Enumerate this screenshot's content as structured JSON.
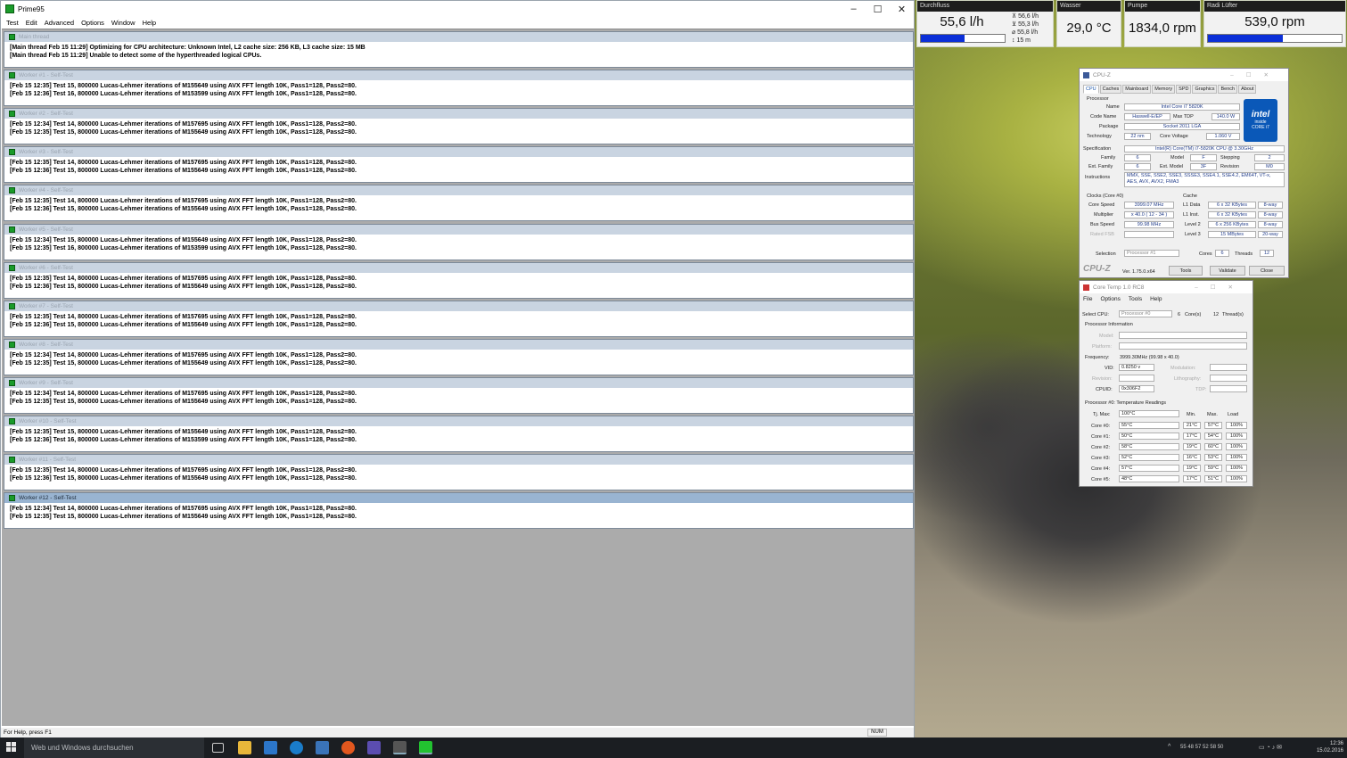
{
  "prime95": {
    "title": "Prime95",
    "menu": [
      "Test",
      "Edit",
      "Advanced",
      "Options",
      "Window",
      "Help"
    ],
    "windows": [
      {
        "caption": "Main thread",
        "lines": [
          "[Main thread Feb 15 11:29] Optimizing for CPU architecture: Unknown Intel, L2 cache size: 256 KB, L3 cache size: 15 MB",
          "[Main thread Feb 15 11:29] Unable to detect some of the hyperthreaded logical CPUs."
        ]
      },
      {
        "caption": "Worker #1 - Self-Test",
        "lines": [
          "[Feb 15 12:35] Test 15, 800000 Lucas-Lehmer iterations of M155649 using AVX FFT length 10K, Pass1=128, Pass2=80.",
          "[Feb 15 12:36] Test 16, 800000 Lucas-Lehmer iterations of M153599 using AVX FFT length 10K, Pass1=128, Pass2=80."
        ]
      },
      {
        "caption": "Worker #2 - Self-Test",
        "lines": [
          "[Feb 15 12:34] Test 14, 800000 Lucas-Lehmer iterations of M157695 using AVX FFT length 10K, Pass1=128, Pass2=80.",
          "[Feb 15 12:35] Test 15, 800000 Lucas-Lehmer iterations of M155649 using AVX FFT length 10K, Pass1=128, Pass2=80."
        ]
      },
      {
        "caption": "Worker #3 - Self-Test",
        "lines": [
          "[Feb 15 12:35] Test 14, 800000 Lucas-Lehmer iterations of M157695 using AVX FFT length 10K, Pass1=128, Pass2=80.",
          "[Feb 15 12:36] Test 15, 800000 Lucas-Lehmer iterations of M155649 using AVX FFT length 10K, Pass1=128, Pass2=80."
        ]
      },
      {
        "caption": "Worker #4 - Self-Test",
        "lines": [
          "[Feb 15 12:35] Test 14, 800000 Lucas-Lehmer iterations of M157695 using AVX FFT length 10K, Pass1=128, Pass2=80.",
          "[Feb 15 12:36] Test 15, 800000 Lucas-Lehmer iterations of M155649 using AVX FFT length 10K, Pass1=128, Pass2=80."
        ]
      },
      {
        "caption": "Worker #5 - Self-Test",
        "lines": [
          "[Feb 15 12:34] Test 15, 800000 Lucas-Lehmer iterations of M155649 using AVX FFT length 10K, Pass1=128, Pass2=80.",
          "[Feb 15 12:35] Test 16, 800000 Lucas-Lehmer iterations of M153599 using AVX FFT length 10K, Pass1=128, Pass2=80."
        ]
      },
      {
        "caption": "Worker #6 - Self-Test",
        "lines": [
          "[Feb 15 12:35] Test 14, 800000 Lucas-Lehmer iterations of M157695 using AVX FFT length 10K, Pass1=128, Pass2=80.",
          "[Feb 15 12:36] Test 15, 800000 Lucas-Lehmer iterations of M155649 using AVX FFT length 10K, Pass1=128, Pass2=80."
        ]
      },
      {
        "caption": "Worker #7 - Self-Test",
        "lines": [
          "[Feb 15 12:35] Test 14, 800000 Lucas-Lehmer iterations of M157695 using AVX FFT length 10K, Pass1=128, Pass2=80.",
          "[Feb 15 12:36] Test 15, 800000 Lucas-Lehmer iterations of M155649 using AVX FFT length 10K, Pass1=128, Pass2=80."
        ]
      },
      {
        "caption": "Worker #8 - Self-Test",
        "lines": [
          "[Feb 15 12:34] Test 14, 800000 Lucas-Lehmer iterations of M157695 using AVX FFT length 10K, Pass1=128, Pass2=80.",
          "[Feb 15 12:35] Test 15, 800000 Lucas-Lehmer iterations of M155649 using AVX FFT length 10K, Pass1=128, Pass2=80."
        ]
      },
      {
        "caption": "Worker #9 - Self-Test",
        "lines": [
          "[Feb 15 12:34] Test 14, 800000 Lucas-Lehmer iterations of M157695 using AVX FFT length 10K, Pass1=128, Pass2=80.",
          "[Feb 15 12:35] Test 15, 800000 Lucas-Lehmer iterations of M155649 using AVX FFT length 10K, Pass1=128, Pass2=80."
        ]
      },
      {
        "caption": "Worker #10 - Self-Test",
        "lines": [
          "[Feb 15 12:35] Test 15, 800000 Lucas-Lehmer iterations of M155649 using AVX FFT length 10K, Pass1=128, Pass2=80.",
          "[Feb 15 12:36] Test 16, 800000 Lucas-Lehmer iterations of M153599 using AVX FFT length 10K, Pass1=128, Pass2=80."
        ]
      },
      {
        "caption": "Worker #11 - Self-Test",
        "lines": [
          "[Feb 15 12:35] Test 14, 800000 Lucas-Lehmer iterations of M157695 using AVX FFT length 10K, Pass1=128, Pass2=80.",
          "[Feb 15 12:36] Test 15, 800000 Lucas-Lehmer iterations of M155649 using AVX FFT length 10K, Pass1=128, Pass2=80."
        ]
      },
      {
        "caption": "Worker #12 - Self-Test",
        "lines": [
          "[Feb 15 12:34] Test 14, 800000 Lucas-Lehmer iterations of M157695 using AVX FFT length 10K, Pass1=128, Pass2=80.",
          "[Feb 15 12:35] Test 15, 800000 Lucas-Lehmer iterations of M155649 using AVX FFT length 10K, Pass1=128, Pass2=80."
        ]
      }
    ],
    "status": "For Help, press F1",
    "num_indicator": "NUM"
  },
  "sensors": {
    "flow": {
      "label": "Durchfluss",
      "value": "55,6 l/h",
      "fill": 0.52,
      "stats": [
        "⊼ 56,6 l/h",
        "⊻ 55,3 l/h",
        "⌀ 55,8 l/h",
        "↕ 15 m"
      ]
    },
    "water": {
      "label": "Wasser",
      "value": "29,0 °C"
    },
    "pump": {
      "label": "Pumpe",
      "value": "1834,0 rpm"
    },
    "fan": {
      "label": "Radi Lüfter",
      "value": "539,0 rpm",
      "fill": 0.56
    }
  },
  "cpuz": {
    "title": "CPU-Z",
    "tabs": [
      "CPU",
      "Caches",
      "Mainboard",
      "Memory",
      "SPD",
      "Graphics",
      "Bench",
      "About"
    ],
    "processor_label": "Processor",
    "name_label": "Name",
    "name": "Intel Core i7 5820K",
    "codename_label": "Code Name",
    "codename": "Haswell-E/EP",
    "maxtdp_label": "Max TDP",
    "maxtdp": "140.0 W",
    "package_label": "Package",
    "package": "Socket 2011 LGA",
    "tech_label": "Technology",
    "tech": "22 nm",
    "voltage_label": "Core Voltage",
    "voltage": "1.060 V",
    "spec_label": "Specification",
    "spec": "Intel(R) Core(TM) i7-5820K CPU @ 3.30GHz",
    "family_label": "Family",
    "family": "6",
    "model_label": "Model",
    "model": "F",
    "stepping_label": "Stepping",
    "stepping": "2",
    "extfamily_label": "Ext. Family",
    "extfamily": "6",
    "extmodel_label": "Ext. Model",
    "extmodel": "3F",
    "revision_label": "Revision",
    "revision": "M0",
    "instr_label": "Instructions",
    "instr": "MMX, SSE, SSE2, SSE3, SSSE3, SSE4.1, SSE4.2, EM64T, VT-x,",
    "instr2": "AES, AVX, AVX2, FMA3",
    "clocks_label": "Clocks (Core #0)",
    "corespeed_label": "Core Speed",
    "corespeed": "3999.07 MHz",
    "mult_label": "Multiplier",
    "mult": "x 40.0 ( 12 - 34 )",
    "bus_label": "Bus Speed",
    "bus": "99.98 MHz",
    "fsb_label": "Rated FSB",
    "cache_label": "Cache",
    "l1d_label": "L1 Data",
    "l1d": "6 x 32 KBytes",
    "l1d_way": "8-way",
    "l1i_label": "L1 Inst.",
    "l1i": "6 x 32 KBytes",
    "l1i_way": "8-way",
    "l2_label": "Level 2",
    "l2": "6 x 256 KBytes",
    "l2_way": "8-way",
    "l3_label": "Level 3",
    "l3": "15 MBytes",
    "l3_way": "20-way",
    "selection_label": "Selection",
    "selection": "Processor #1",
    "cores_label": "Cores",
    "cores": "6",
    "threads_label": "Threads",
    "threads": "12",
    "brand": "CPU-Z",
    "version": "Ver. 1.75.0.x64",
    "tools": "Tools",
    "validate": "Validate",
    "close": "Close",
    "logo_text": "intel",
    "logo_sub1": "inside",
    "logo_sub2": "CORE i7"
  },
  "coretemp": {
    "title": "Core Temp 1.0 RC8",
    "menu": [
      "File",
      "Options",
      "Tools",
      "Help"
    ],
    "selectcpu_label": "Select CPU:",
    "selectcpu": "Processor #0",
    "cores": "6",
    "cores_label": "Core(s)",
    "threads": "12",
    "threads_label": "Thread(s)",
    "procinfo_label": "Processor Information",
    "model_label": "Model:",
    "platform_label": "Platform:",
    "freq_label": "Frequency:",
    "freq": "3999.30MHz (99.98 x 40.0)",
    "vid_label": "VID:",
    "vid": "0.8250 v",
    "modulation_label": "Modulation:",
    "revision_label": "Revision:",
    "litho_label": "Lithography:",
    "cpuid_label": "CPUID:",
    "cpuid": "0x306F2",
    "tdp_label": "TDP:",
    "readings_label": "Processor #0: Temperature Readings",
    "tjmax_label": "Tj. Max:",
    "tjmax": "100°C",
    "col_min": "Min.",
    "col_max": "Max.",
    "col_load": "Load",
    "rows": [
      {
        "label": "Core #0:",
        "temp": "55°C",
        "min": "21°C",
        "max": "57°C",
        "load": "100%"
      },
      {
        "label": "Core #1:",
        "temp": "50°C",
        "min": "17°C",
        "max": "54°C",
        "load": "100%"
      },
      {
        "label": "Core #2:",
        "temp": "58°C",
        "min": "19°C",
        "max": "60°C",
        "load": "100%"
      },
      {
        "label": "Core #3:",
        "temp": "52°C",
        "min": "16°C",
        "max": "53°C",
        "load": "100%"
      },
      {
        "label": "Core #4:",
        "temp": "57°C",
        "min": "19°C",
        "max": "59°C",
        "load": "100%"
      },
      {
        "label": "Core #5:",
        "temp": "48°C",
        "min": "17°C",
        "max": "51°C",
        "load": "100%"
      }
    ]
  },
  "taskbar": {
    "search_placeholder": "Web und Windows durchsuchen",
    "tray_temps": "55  48  57  52  58  50",
    "time": "12:36",
    "date": "15.02.2016"
  }
}
